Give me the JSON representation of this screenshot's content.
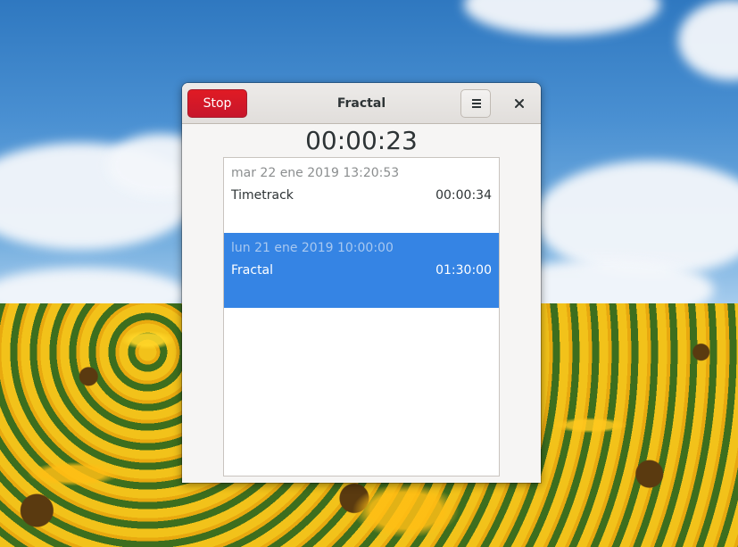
{
  "window": {
    "title": "Fractal",
    "stop_label": "Stop",
    "elapsed": "00:00:23"
  },
  "entries": [
    {
      "date": "mar 22 ene 2019 13:20:53",
      "name": "Timetrack",
      "duration": "00:00:34",
      "selected": false
    },
    {
      "date": "lun 21 ene 2019 10:00:00",
      "name": "Fractal",
      "duration": "01:30:00",
      "selected": true
    }
  ],
  "icons": {
    "menu": "hamburger-menu-icon",
    "close": "close-icon"
  },
  "colors": {
    "stop_button": "#e01b24",
    "selection": "#3584e4",
    "window_bg": "#f6f5f4"
  }
}
